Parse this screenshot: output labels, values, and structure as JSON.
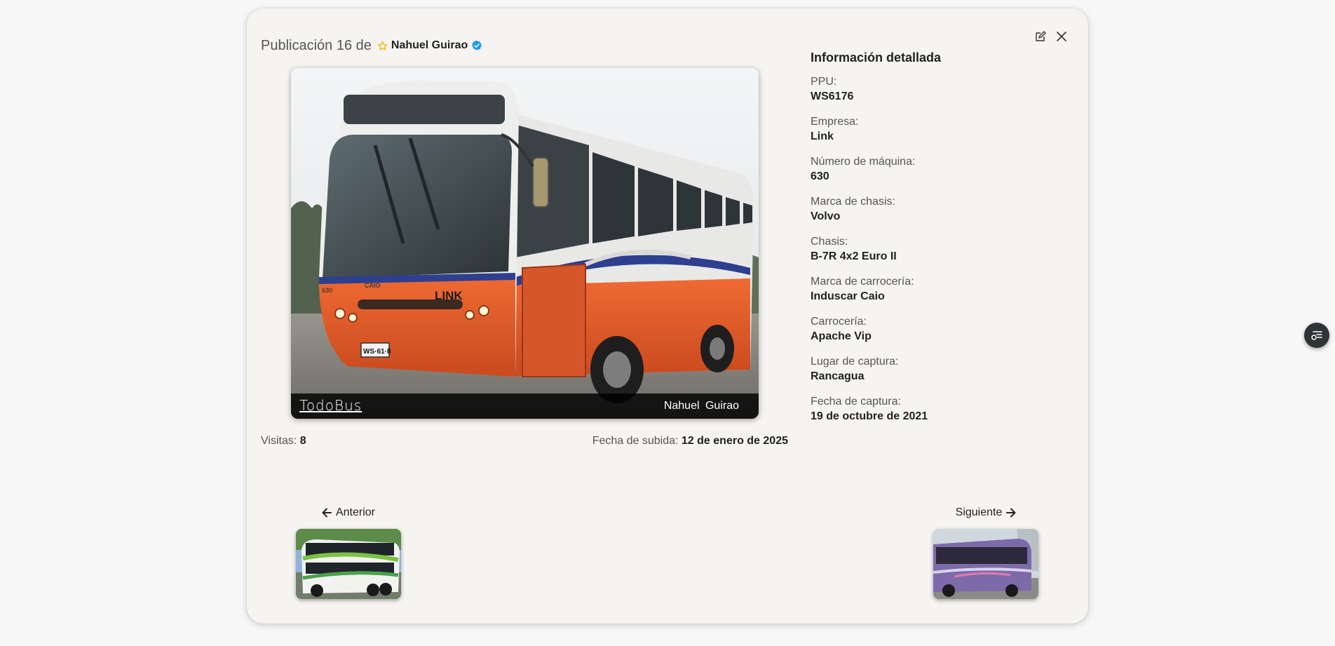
{
  "header": {
    "title_prefix": "Publicación 16 de",
    "author": "Nahuel Guirao"
  },
  "photo": {
    "watermark_brand": "TodoBus",
    "watermark_author": "Nahuel Guirao",
    "bus_logo_text": "LINK",
    "plate_text": "WS·61·8",
    "fleet_number_text": "630",
    "body_badge_text": "CAIO"
  },
  "stats": {
    "visits_label": "Visitas:",
    "visits_value": "8",
    "upload_label": "Fecha de subida:",
    "upload_value": "12 de enero de 2025"
  },
  "info": {
    "heading": "Información detallada",
    "fields": [
      {
        "label": "PPU:",
        "value": "WS6176"
      },
      {
        "label": "Empresa:",
        "value": "Link"
      },
      {
        "label": "Número de máquina:",
        "value": "630"
      },
      {
        "label": "Marca de chasis:",
        "value": "Volvo"
      },
      {
        "label": "Chasis:",
        "value": "B-7R 4x2 Euro II"
      },
      {
        "label": "Marca de carrocería:",
        "value": "Induscar Caio"
      },
      {
        "label": "Carrocería:",
        "value": "Apache Vip"
      },
      {
        "label": "Lugar de captura:",
        "value": "Rancagua"
      },
      {
        "label": "Fecha de captura:",
        "value": "19 de octubre de 2021"
      }
    ]
  },
  "nav": {
    "prev_label": "Anterior",
    "next_label": "Siguiente"
  },
  "icons": {
    "edit": "edit-icon",
    "close": "close-icon",
    "star": "star-icon",
    "verified": "verified-badge-icon",
    "arrow_left": "arrow-left-icon",
    "arrow_right": "arrow-right-icon",
    "filter_list": "filter-list-icon"
  },
  "colors": {
    "star": "#f2b705",
    "verified": "#1d9bf0",
    "bus_orange": "#e65a2a",
    "modal_bg": "#f6f4f1"
  }
}
